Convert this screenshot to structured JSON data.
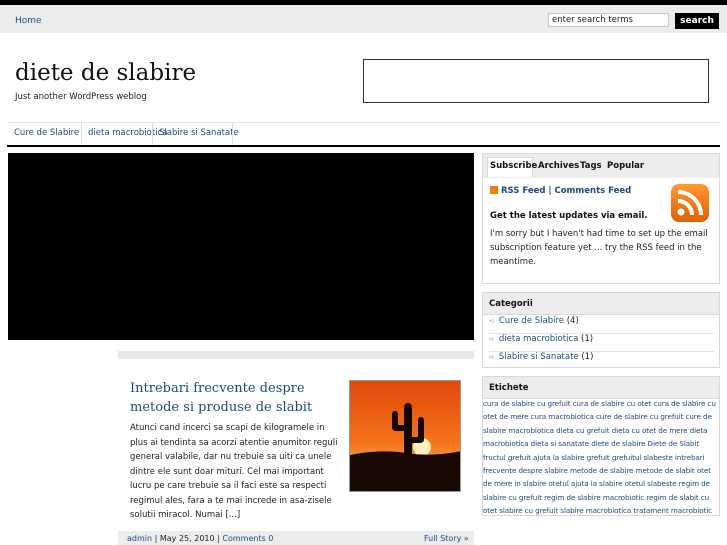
{
  "header": {
    "nav_home": "Home",
    "search_placeholder": "enter search terms",
    "search_button": "search",
    "site_title": "diete de slabire",
    "site_description": "Just another WordPress weblog"
  },
  "menu": {
    "items": [
      "Cure de Slabire",
      "dieta macrobiotica",
      "Slabire si Sanatate"
    ]
  },
  "post": {
    "title": "Intrebari frecvente despre metode si produse de slabit",
    "excerpt": "Atunci cand incerci sa scapi de kilogramele in plus ai tendinta sa acorzi atentie anumitor reguli general valabile, dar nu trebuie sa uiti ca unele dintre ele sunt doar mituri. Cel mai important lucru pe care trebuie sa il faci este sa respecti regimul ales, fara a te mai increde in asa-zisele solutii miracol. Numai [...]",
    "author": "admin",
    "date": "May 25, 2010",
    "comments": "Comments 0",
    "full_story": "Full Story »"
  },
  "sidebar": {
    "tabs": [
      "Subscribe",
      "Archives",
      "Tags",
      "Popular"
    ],
    "rss_feed": "RSS Feed",
    "comments_feed": "Comments Feed",
    "updates_title": "Get the latest updates via email.",
    "updates_text": "I'm sorry but I haven't had time to set up the email subscription feature yet ... try the RSS feed in the meantime.",
    "categories_title": "Categorii",
    "categories": [
      {
        "name": "Cure de Slabire",
        "count": "(4)"
      },
      {
        "name": "dieta macrobiotica",
        "count": "(1)"
      },
      {
        "name": "Slabire si Sanatate",
        "count": "(1)"
      }
    ],
    "tags_title": "Etichete",
    "tags_text": "cura de slabire cu grefult cura de slabire cu otet cura de slabire cu otet de mere cura macrobiotica cure de slabire cu grefuit cure de slabire macrobiotica dieta cu grefuit dieta cu otet de mere dieta macrobiotica dieta si sanatate diete de slabire Diete de Slabit fructul grefuit ajuta la slabire grefuit grefuitul slabeste intrebari frecvente despre slabire metode de slabire metode de slabit otet de mere in slabire otetul ajuta la slabire otetul slabeste regim de slabire cu grefuit regim de slabire macrobiotic regim de slabit cu otet slabire cu grefuit slabire macrobiotica tratament macrobiotic"
  },
  "colors": {
    "link": "#1c4b7d",
    "rss_orange": "#f57c00"
  }
}
